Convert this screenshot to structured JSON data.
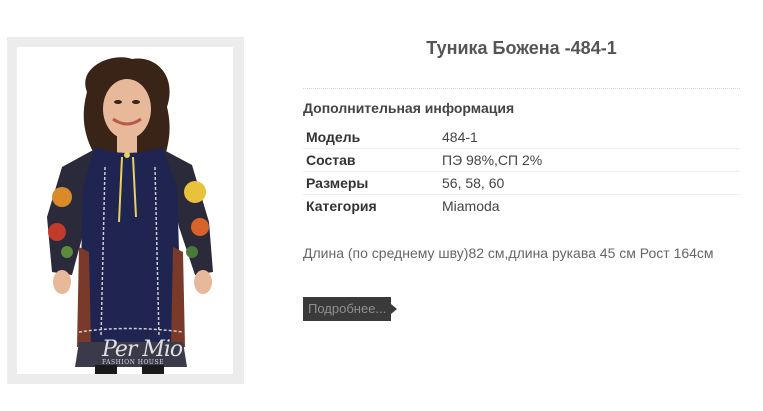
{
  "product": {
    "title": "Туника Божена -484-1",
    "image_watermark": "Per Mio",
    "image_watermark_sub": "FASHION HOUSE"
  },
  "info": {
    "heading": "Дополнительная информация",
    "rows": [
      {
        "label": "Модель",
        "value": "484-1"
      },
      {
        "label": "Состав",
        "value": "ПЭ 98%,СП 2%"
      },
      {
        "label": "Размеры",
        "value": "56, 58, 60"
      },
      {
        "label": "Категория",
        "value": "Miamoda"
      }
    ]
  },
  "description": "Длина (по среднему шву)82 см,длина рукава 45 см Рост 164см",
  "more_button": {
    "label": "Подробнее..."
  },
  "colors": {
    "button_bg": "#3a3a3a",
    "button_text": "#8f8f8f",
    "tunic": "#1f2450"
  }
}
